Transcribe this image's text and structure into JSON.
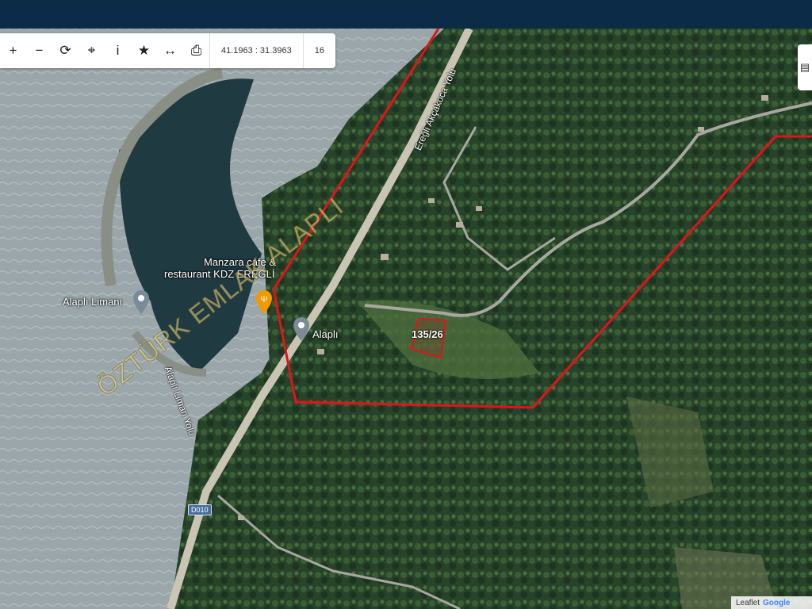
{
  "topbar": {
    "color": "#0c2b46"
  },
  "toolbar": {
    "buttons": [
      {
        "name": "zoom-in-button",
        "icon": "plus-icon",
        "glyph": "+"
      },
      {
        "name": "zoom-out-button",
        "icon": "minus-icon",
        "glyph": "−"
      },
      {
        "name": "refresh-button",
        "icon": "refresh-icon",
        "glyph": "⟳"
      },
      {
        "name": "locate-button",
        "icon": "crosshair-icon",
        "glyph": "⌖"
      },
      {
        "name": "info-button",
        "icon": "info-icon",
        "glyph": "i"
      },
      {
        "name": "favorite-button",
        "icon": "star-icon",
        "glyph": "★"
      },
      {
        "name": "measure-button",
        "icon": "arrows-horizontal-icon",
        "glyph": "↔"
      },
      {
        "name": "print-button",
        "icon": "printer-icon",
        "glyph": "⎙"
      }
    ],
    "coordinates": "41.1963 : 31.3963",
    "zoom": "16"
  },
  "map": {
    "labels": {
      "restaurant": "Manzara cafe &\nrestaurant KDZ EREĞLİ",
      "harbor": "Alaplı Limanı",
      "town": "Alaplı",
      "parcel": "135/26",
      "road_akcakoca": "Ereğli Akçakoca Yolu",
      "road_liman": "Alaplı Liman Yolu",
      "road_shield": "D010"
    },
    "watermark": "ÖZTÜRK EMLAK ALAPLI",
    "boundary_color": "#e0141a",
    "attribution": {
      "leaflet": "Leaflet",
      "google": "Google"
    }
  }
}
